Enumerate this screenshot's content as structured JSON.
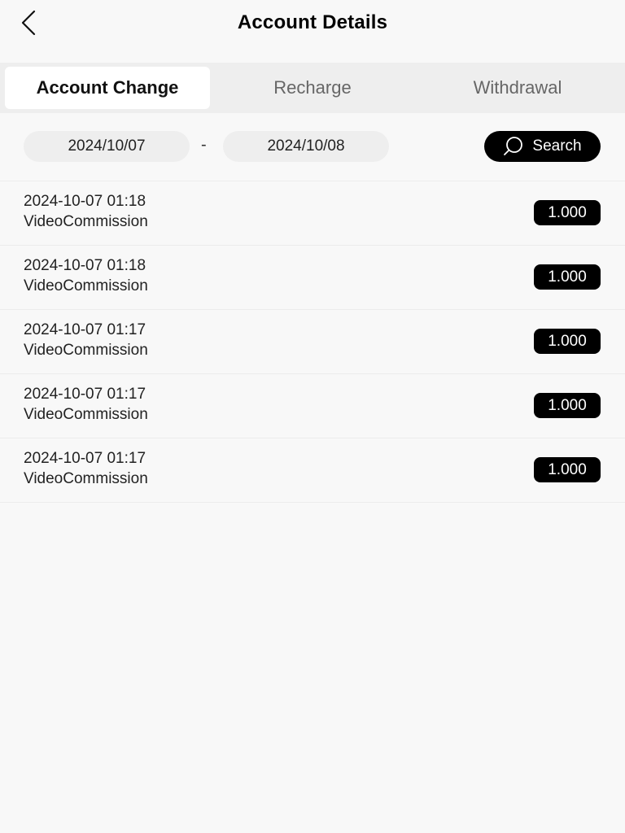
{
  "header": {
    "title": "Account Details",
    "back_icon": "chevron-left-icon"
  },
  "tabs": [
    {
      "label": "Account Change",
      "active": true
    },
    {
      "label": "Recharge",
      "active": false
    },
    {
      "label": "Withdrawal",
      "active": false
    }
  ],
  "filter": {
    "start_date": "2024/10/07",
    "separator": "-",
    "end_date": "2024/10/08",
    "search_label": "Search",
    "search_icon": "search-icon"
  },
  "records": [
    {
      "time": "2024-10-07 01:18",
      "type": "VideoCommission",
      "amount": "1.000"
    },
    {
      "time": "2024-10-07 01:18",
      "type": "VideoCommission",
      "amount": "1.000"
    },
    {
      "time": "2024-10-07 01:17",
      "type": "VideoCommission",
      "amount": "1.000"
    },
    {
      "time": "2024-10-07 01:17",
      "type": "VideoCommission",
      "amount": "1.000"
    },
    {
      "time": "2024-10-07 01:17",
      "type": "VideoCommission",
      "amount": "1.000"
    }
  ],
  "colors": {
    "background": "#f8f8f8",
    "tab_bar": "#eeeeee",
    "accent": "#000000"
  }
}
